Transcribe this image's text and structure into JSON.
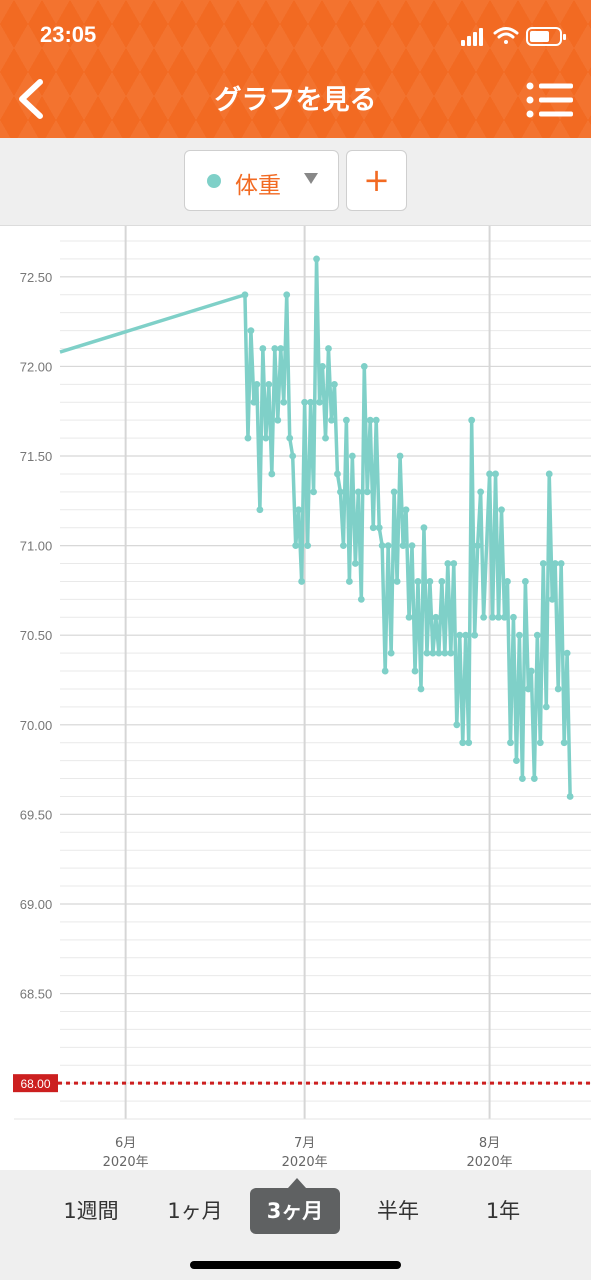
{
  "status_bar": {
    "time": "23:05"
  },
  "nav": {
    "title": "グラフを見る"
  },
  "toolbar": {
    "metric_label": "体重",
    "add_label": "+"
  },
  "range_tabs": [
    {
      "label": "1週間",
      "active": false
    },
    {
      "label": "1ヶ月",
      "active": false
    },
    {
      "label": "3ヶ月",
      "active": true
    },
    {
      "label": "半年",
      "active": false
    },
    {
      "label": "1年",
      "active": false
    }
  ],
  "colors": {
    "header": "#f26a22",
    "series": "#7fd0c8",
    "target": "#cc1f1f",
    "active_tab": "#5f6162"
  },
  "chart_data": {
    "type": "line",
    "y_ticks": [
      "72.50",
      "72.00",
      "71.50",
      "71.00",
      "70.50",
      "70.00",
      "69.50",
      "69.00",
      "68.50"
    ],
    "ylim": [
      67.8,
      72.7
    ],
    "x_ticks": [
      {
        "month": "6月",
        "year": "2020年",
        "date": "2020-06-01"
      },
      {
        "month": "7月",
        "year": "2020年",
        "date": "2020-07-01"
      },
      {
        "month": "8月",
        "year": "2020年",
        "date": "2020-08-01"
      }
    ],
    "xlim": [
      "2020-05-21",
      "2020-08-18"
    ],
    "target": {
      "value": 68.0,
      "label": "68.00"
    },
    "series": [
      {
        "points": [
          [
            "2020-05-21",
            72.08
          ],
          [
            "2020-06-21",
            72.4
          ],
          [
            "2020-06-21",
            71.6
          ],
          [
            "2020-06-22",
            72.2
          ],
          [
            "2020-06-22",
            71.8
          ],
          [
            "2020-06-23",
            71.9
          ],
          [
            "2020-06-23",
            71.2
          ],
          [
            "2020-06-24",
            72.1
          ],
          [
            "2020-06-24",
            71.6
          ],
          [
            "2020-06-25",
            71.9
          ],
          [
            "2020-06-25",
            71.4
          ],
          [
            "2020-06-26",
            72.1
          ],
          [
            "2020-06-26",
            71.7
          ],
          [
            "2020-06-27",
            72.1
          ],
          [
            "2020-06-27",
            71.8
          ],
          [
            "2020-06-28",
            72.4
          ],
          [
            "2020-06-28",
            71.6
          ],
          [
            "2020-06-29",
            71.5
          ],
          [
            "2020-06-29",
            71.0
          ],
          [
            "2020-06-30",
            71.2
          ],
          [
            "2020-06-30",
            70.8
          ],
          [
            "2020-07-01",
            71.8
          ],
          [
            "2020-07-01",
            71.0
          ],
          [
            "2020-07-02",
            71.8
          ],
          [
            "2020-07-02",
            71.3
          ],
          [
            "2020-07-03",
            72.6
          ],
          [
            "2020-07-03",
            71.8
          ],
          [
            "2020-07-04",
            72.0
          ],
          [
            "2020-07-04",
            71.6
          ],
          [
            "2020-07-05",
            72.1
          ],
          [
            "2020-07-05",
            71.7
          ],
          [
            "2020-07-06",
            71.9
          ],
          [
            "2020-07-06",
            71.4
          ],
          [
            "2020-07-07",
            71.3
          ],
          [
            "2020-07-07",
            71.0
          ],
          [
            "2020-07-08",
            71.7
          ],
          [
            "2020-07-08",
            70.8
          ],
          [
            "2020-07-09",
            71.5
          ],
          [
            "2020-07-09",
            70.9
          ],
          [
            "2020-07-10",
            71.3
          ],
          [
            "2020-07-10",
            70.7
          ],
          [
            "2020-07-11",
            72.0
          ],
          [
            "2020-07-11",
            71.3
          ],
          [
            "2020-07-12",
            71.7
          ],
          [
            "2020-07-12",
            71.1
          ],
          [
            "2020-07-13",
            71.7
          ],
          [
            "2020-07-13",
            71.1
          ],
          [
            "2020-07-14",
            71.0
          ],
          [
            "2020-07-14",
            70.3
          ],
          [
            "2020-07-15",
            71.0
          ],
          [
            "2020-07-15",
            70.4
          ],
          [
            "2020-07-16",
            71.3
          ],
          [
            "2020-07-16",
            70.8
          ],
          [
            "2020-07-17",
            71.5
          ],
          [
            "2020-07-17",
            71.0
          ],
          [
            "2020-07-18",
            71.2
          ],
          [
            "2020-07-18",
            70.6
          ],
          [
            "2020-07-19",
            71.0
          ],
          [
            "2020-07-19",
            70.3
          ],
          [
            "2020-07-20",
            70.8
          ],
          [
            "2020-07-20",
            70.2
          ],
          [
            "2020-07-21",
            71.1
          ],
          [
            "2020-07-21",
            70.4
          ],
          [
            "2020-07-22",
            70.8
          ],
          [
            "2020-07-22",
            70.4
          ],
          [
            "2020-07-23",
            70.6
          ],
          [
            "2020-07-23",
            70.4
          ],
          [
            "2020-07-24",
            70.8
          ],
          [
            "2020-07-24",
            70.4
          ],
          [
            "2020-07-25",
            70.9
          ],
          [
            "2020-07-25",
            70.4
          ],
          [
            "2020-07-26",
            70.9
          ],
          [
            "2020-07-26",
            70.0
          ],
          [
            "2020-07-27",
            70.5
          ],
          [
            "2020-07-27",
            69.9
          ],
          [
            "2020-07-28",
            70.5
          ],
          [
            "2020-07-28",
            69.9
          ],
          [
            "2020-07-29",
            71.7
          ],
          [
            "2020-07-29",
            70.5
          ],
          [
            "2020-07-30",
            71.0
          ],
          [
            "2020-07-30",
            71.3
          ],
          [
            "2020-07-31",
            70.6
          ],
          [
            "2020-08-01",
            71.4
          ],
          [
            "2020-08-01",
            70.6
          ],
          [
            "2020-08-02",
            71.4
          ],
          [
            "2020-08-02",
            70.6
          ],
          [
            "2020-08-03",
            71.2
          ],
          [
            "2020-08-03",
            70.6
          ],
          [
            "2020-08-04",
            70.8
          ],
          [
            "2020-08-04",
            69.9
          ],
          [
            "2020-08-05",
            70.6
          ],
          [
            "2020-08-05",
            69.8
          ],
          [
            "2020-08-06",
            70.5
          ],
          [
            "2020-08-06",
            69.7
          ],
          [
            "2020-08-07",
            70.8
          ],
          [
            "2020-08-07",
            70.2
          ],
          [
            "2020-08-08",
            70.3
          ],
          [
            "2020-08-08",
            69.7
          ],
          [
            "2020-08-09",
            70.5
          ],
          [
            "2020-08-09",
            69.9
          ],
          [
            "2020-08-10",
            70.9
          ],
          [
            "2020-08-10",
            70.1
          ],
          [
            "2020-08-11",
            71.4
          ],
          [
            "2020-08-11",
            70.7
          ],
          [
            "2020-08-12",
            70.9
          ],
          [
            "2020-08-12",
            70.2
          ],
          [
            "2020-08-13",
            70.9
          ],
          [
            "2020-08-13",
            69.9
          ],
          [
            "2020-08-14",
            70.4
          ],
          [
            "2020-08-14",
            69.6
          ]
        ]
      }
    ]
  }
}
